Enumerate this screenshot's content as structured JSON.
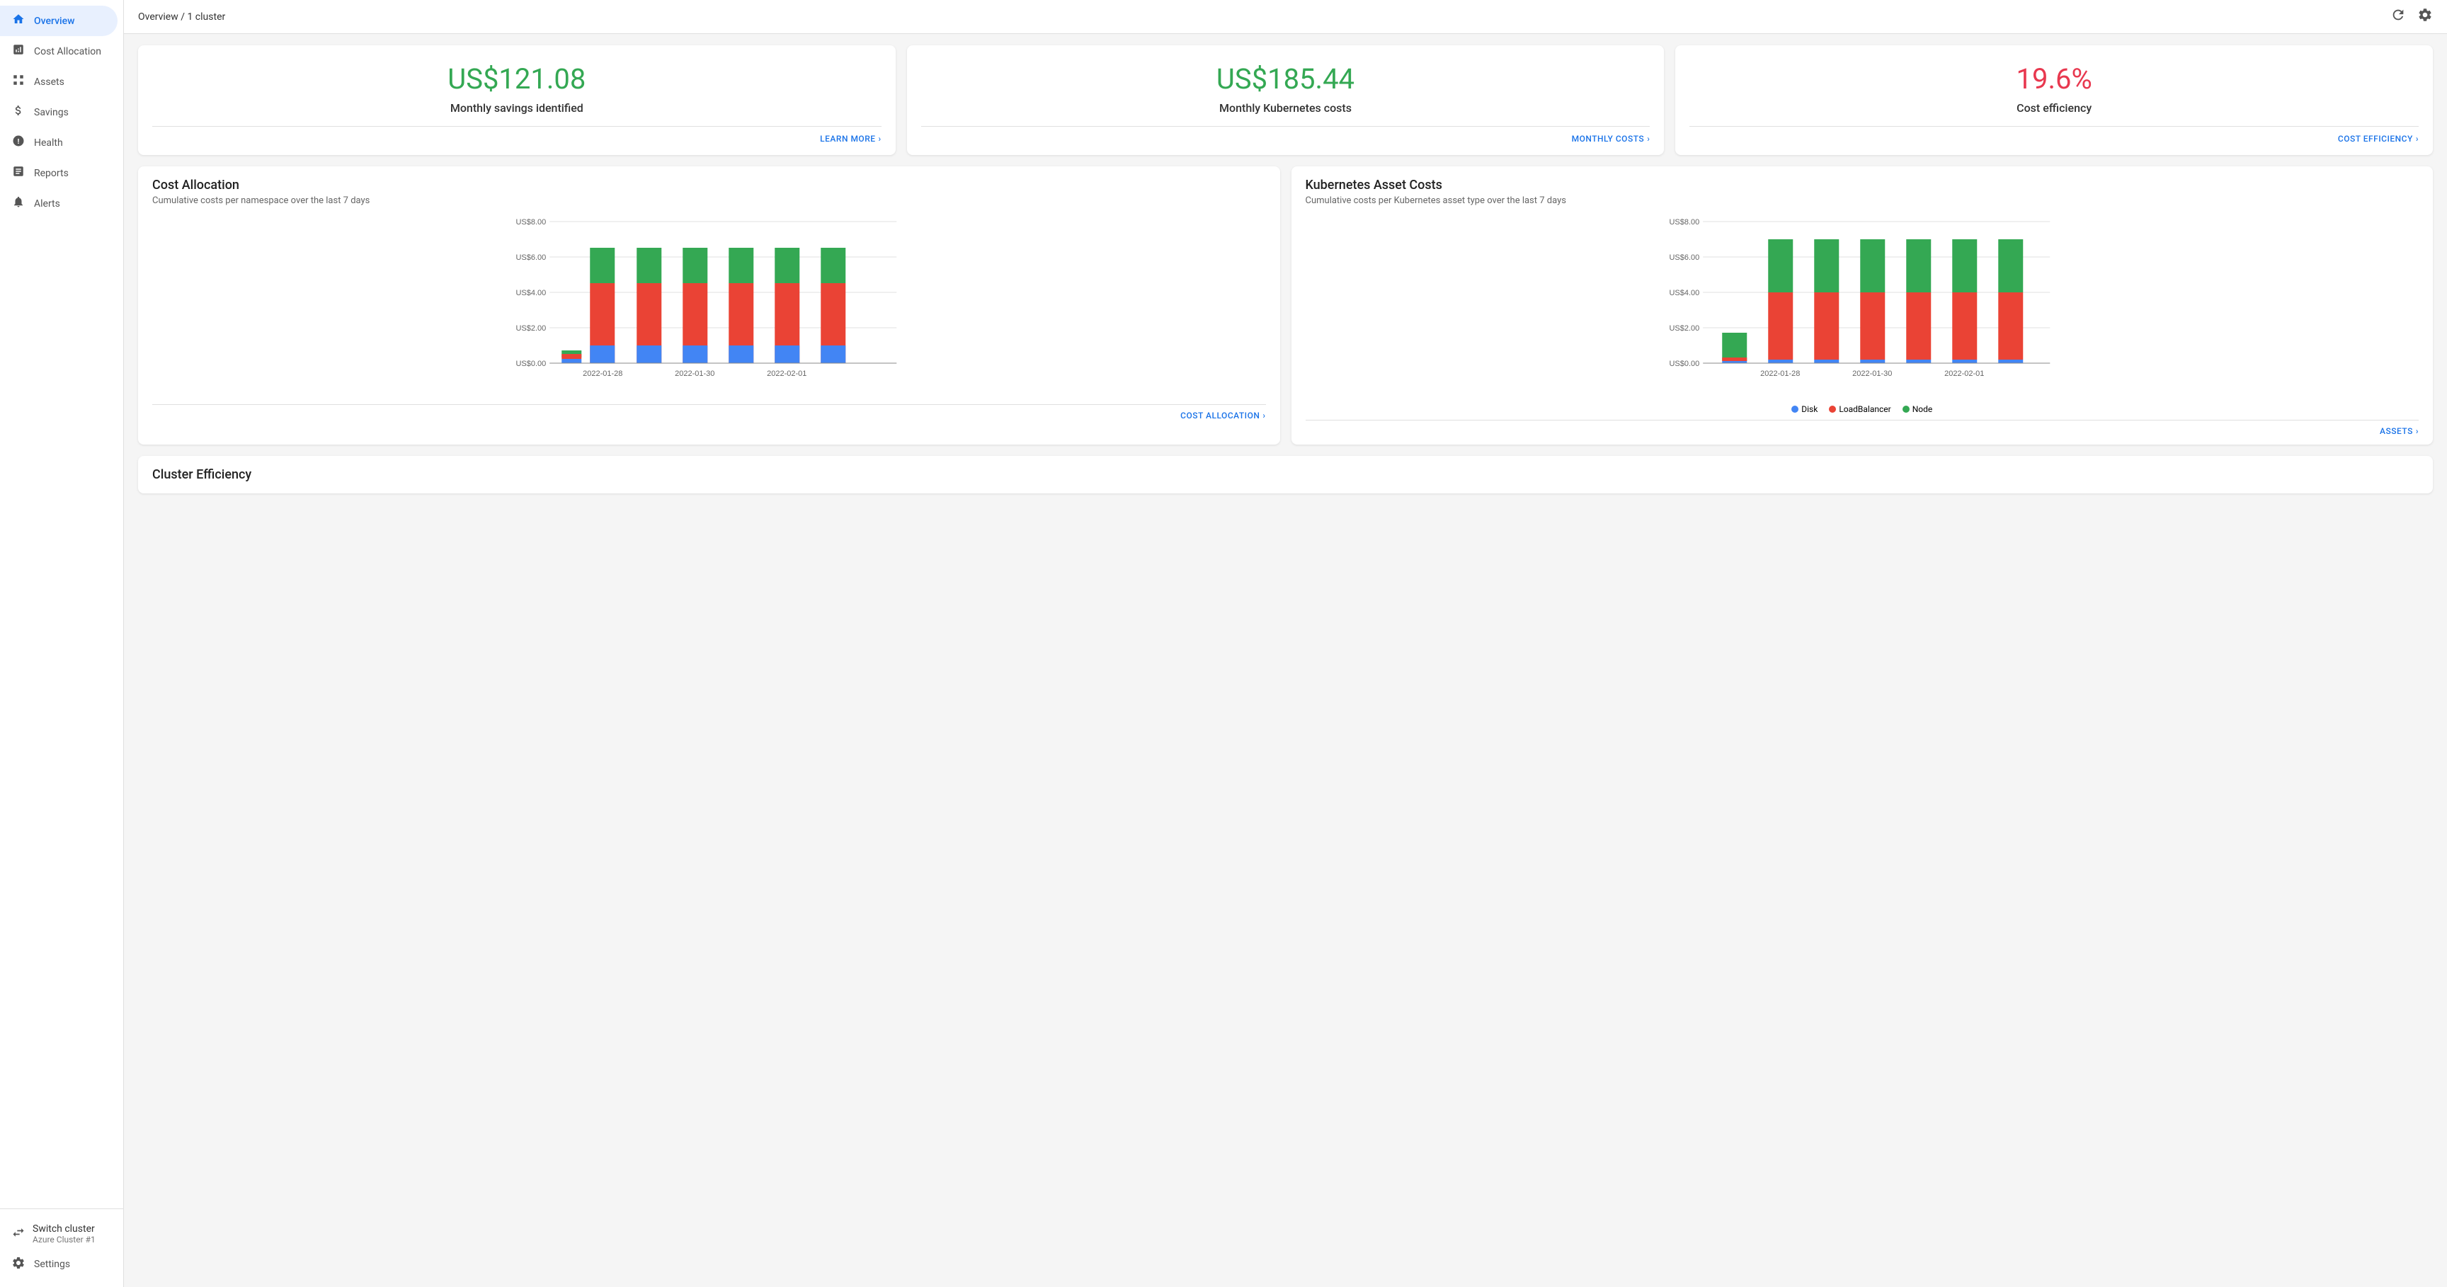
{
  "sidebar": {
    "items": [
      {
        "id": "overview",
        "label": "Overview",
        "icon": "🏠",
        "active": true
      },
      {
        "id": "cost-allocation",
        "label": "Cost Allocation",
        "icon": "📊"
      },
      {
        "id": "assets",
        "label": "Assets",
        "icon": "🗃"
      },
      {
        "id": "savings",
        "label": "Savings",
        "icon": "💲"
      },
      {
        "id": "health",
        "label": "Health",
        "icon": "ℹ"
      },
      {
        "id": "reports",
        "label": "Reports",
        "icon": "📋"
      },
      {
        "id": "alerts",
        "label": "Alerts",
        "icon": "🔔"
      }
    ],
    "switch_cluster_label": "Switch cluster",
    "switch_cluster_sub": "Azure Cluster #1",
    "settings_label": "Settings"
  },
  "topbar": {
    "breadcrumb": "Overview / 1 cluster"
  },
  "cards": [
    {
      "value": "US$121.08",
      "color": "green",
      "label": "Monthly savings identified",
      "link_text": "LEARN MORE",
      "link_arrow": "›"
    },
    {
      "value": "US$185.44",
      "color": "green",
      "label": "Monthly Kubernetes costs",
      "link_text": "MONTHLY COSTS",
      "link_arrow": "›"
    },
    {
      "value": "19.6%",
      "color": "pink",
      "label": "Cost efficiency",
      "link_text": "COST EFFICIENCY",
      "link_arrow": "›"
    }
  ],
  "cost_allocation_chart": {
    "title": "Cost Allocation",
    "subtitle": "Cumulative costs per namespace over the last 7 days",
    "link_text": "COST ALLOCATION",
    "y_labels": [
      "US$8.00",
      "US$6.00",
      "US$4.00",
      "US$2.00",
      "US$0.00"
    ],
    "x_labels": [
      "2022-01-28",
      "2022-01-30",
      "2022-02-01"
    ],
    "bars": [
      {
        "x": 0.2,
        "blue": 0.0,
        "red": 0.1,
        "green": 0.15
      },
      {
        "x": 0.35,
        "blue": 1.2,
        "red": 3.5,
        "green": 1.3
      },
      {
        "x": 0.47,
        "blue": 1.2,
        "red": 3.5,
        "green": 1.3
      },
      {
        "x": 0.57,
        "blue": 1.2,
        "red": 3.5,
        "green": 1.3
      },
      {
        "x": 0.67,
        "blue": 1.2,
        "red": 3.5,
        "green": 1.3
      },
      {
        "x": 0.77,
        "blue": 1.2,
        "red": 3.5,
        "green": 1.3
      },
      {
        "x": 0.87,
        "blue": 1.2,
        "red": 3.5,
        "green": 1.3
      }
    ]
  },
  "kubernetes_asset_chart": {
    "title": "Kubernetes Asset Costs",
    "subtitle": "Cumulative costs per Kubernetes asset type over the last 7 days",
    "link_text": "ASSETS",
    "y_labels": [
      "US$8.00",
      "US$6.00",
      "US$4.00",
      "US$2.00",
      "US$0.00"
    ],
    "x_labels": [
      "2022-01-28",
      "2022-01-30",
      "2022-02-01"
    ],
    "legend": [
      {
        "label": "Disk",
        "color": "#4285f4"
      },
      {
        "label": "LoadBalancer",
        "color": "#ea4335"
      },
      {
        "label": "Node",
        "color": "#34a853"
      }
    ]
  },
  "cluster_efficiency": {
    "title": "Cluster Efficiency"
  },
  "colors": {
    "blue": "#4285f4",
    "red": "#ea4335",
    "green": "#34a853",
    "accent": "#1a73e8"
  }
}
